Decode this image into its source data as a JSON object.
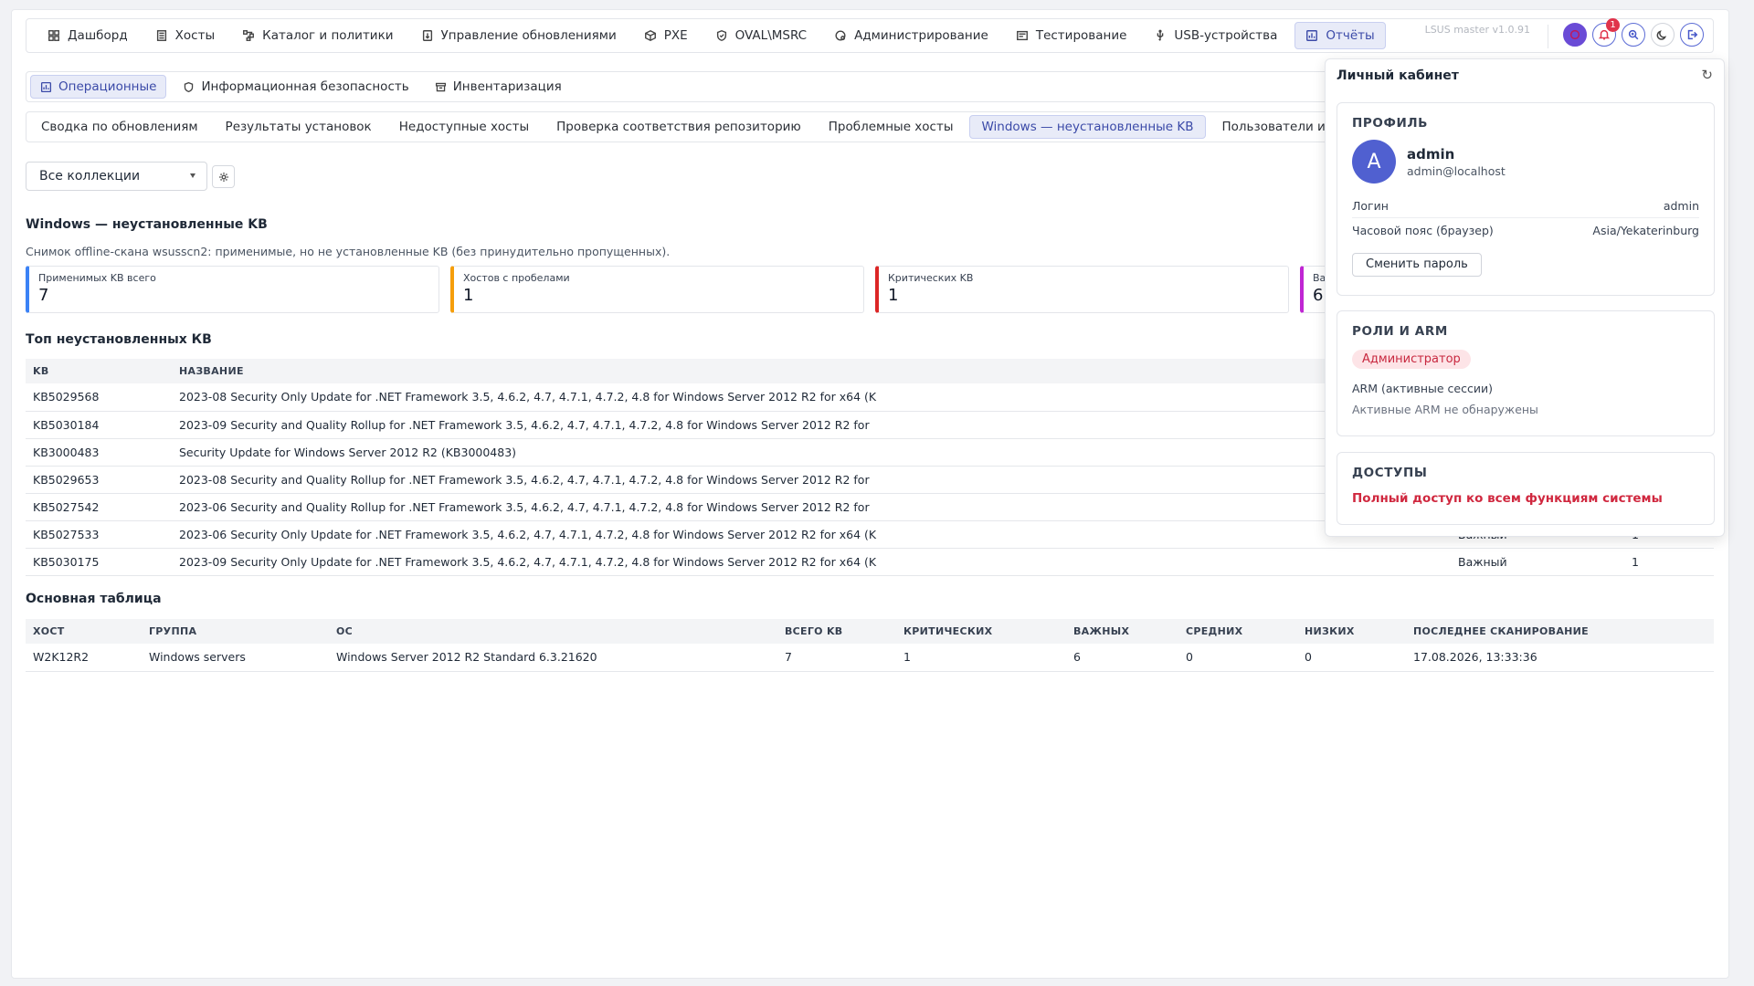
{
  "app": {
    "version": "LSUS master v1.0.91"
  },
  "topnav": {
    "items": [
      {
        "label": "Дашборд",
        "icon": "dashboard-icon"
      },
      {
        "label": "Хосты",
        "icon": "server-icon"
      },
      {
        "label": "Каталог и политики",
        "icon": "catalog-icon"
      },
      {
        "label": "Управление обновлениями",
        "icon": "update-icon"
      },
      {
        "label": "PXE",
        "icon": "cube-icon"
      },
      {
        "label": "OVAL\\MSRC",
        "icon": "shield-check-icon"
      },
      {
        "label": "Администрирование",
        "icon": "admin-icon"
      },
      {
        "label": "Тестирование",
        "icon": "test-icon"
      },
      {
        "label": "USB-устройства",
        "icon": "usb-icon"
      },
      {
        "label": "Отчёты",
        "icon": "report-icon",
        "active": true
      }
    ],
    "notifications_count": "1"
  },
  "subnav": {
    "items": [
      {
        "label": "Операционные",
        "icon": "report-icon",
        "active": true
      },
      {
        "label": "Информационная безопасность",
        "icon": "shield-icon"
      },
      {
        "label": "Инвентаризация",
        "icon": "archive-icon"
      }
    ]
  },
  "tabs": [
    {
      "label": "Сводка по обновлениям"
    },
    {
      "label": "Результаты установок"
    },
    {
      "label": "Недоступные хосты"
    },
    {
      "label": "Проверка соответствия репозиторию"
    },
    {
      "label": "Проблемные хосты"
    },
    {
      "label": "Windows — неустановленные KB",
      "active": true
    },
    {
      "label": "Пользователи и входы"
    }
  ],
  "filter": {
    "collection": "Все коллекции"
  },
  "report": {
    "title": "Windows — неустановленные KB",
    "description": "Снимок offline-скана wsusscn2: применимые, но не установленные KB (без принудительно пропущенных).",
    "cards": [
      {
        "label": "Применимых KB всего",
        "value": "7",
        "color": "#3b82f6"
      },
      {
        "label": "Хостов с пробелами",
        "value": "1",
        "color": "#f59e0b"
      },
      {
        "label": "Критических KB",
        "value": "1",
        "color": "#dc2626"
      },
      {
        "label": "Ва",
        "value": "6",
        "color": "#c026d3"
      }
    ],
    "top_title": "Топ неустановленных КВ",
    "top_columns": [
      "KB",
      "НАЗВАНИЕ",
      "",
      ""
    ],
    "top_rows": [
      {
        "kb": "KB5029568",
        "name": "2023-08 Security Only Update for .NET Framework 3.5, 4.6.2, 4.7, 4.7.1, 4.7.2, 4.8 for Windows Server 2012 R2 for x64 (K",
        "severity": "",
        "count": ""
      },
      {
        "kb": "KB5030184",
        "name": "2023-09 Security and Quality Rollup for .NET Framework 3.5, 4.6.2, 4.7, 4.7.1, 4.7.2, 4.8 for Windows Server 2012 R2 for",
        "severity": "",
        "count": ""
      },
      {
        "kb": "KB3000483",
        "name": "Security Update for Windows Server 2012 R2 (KB3000483)",
        "severity": "",
        "count": ""
      },
      {
        "kb": "KB5029653",
        "name": "2023-08 Security and Quality Rollup for .NET Framework 3.5, 4.6.2, 4.7, 4.7.1, 4.7.2, 4.8 for Windows Server 2012 R2 for",
        "severity": "",
        "count": ""
      },
      {
        "kb": "KB5027542",
        "name": "2023-06 Security and Quality Rollup for .NET Framework 3.5, 4.6.2, 4.7, 4.7.1, 4.7.2, 4.8 for Windows Server 2012 R2 for",
        "severity": "",
        "count": ""
      },
      {
        "kb": "KB5027533",
        "name": "2023-06 Security Only Update for .NET Framework 3.5, 4.6.2, 4.7, 4.7.1, 4.7.2, 4.8 for Windows Server 2012 R2 for x64 (K",
        "severity": "Важный",
        "count": "1"
      },
      {
        "kb": "KB5030175",
        "name": "2023-09 Security Only Update for .NET Framework 3.5, 4.6.2, 4.7, 4.7.1, 4.7.2, 4.8 for Windows Server 2012 R2 for x64 (K",
        "severity": "Важный",
        "count": "1"
      }
    ],
    "main_title": "Основная таблица",
    "main_columns": [
      "ХОСТ",
      "ГРУППА",
      "ОС",
      "ВСЕГО KB",
      "КРИТИЧЕСКИХ",
      "ВАЖНЫХ",
      "СРЕДНИХ",
      "НИЗКИХ",
      "ПОСЛЕДНЕЕ СКАНИРОВАНИЕ"
    ],
    "main_rows": [
      [
        "W2K12R2",
        "Windows servers",
        "Windows Server 2012 R2 Standard 6.3.21620",
        "7",
        "1",
        "6",
        "0",
        "0",
        "17.08.2026, 13:33:36"
      ]
    ]
  },
  "profile": {
    "title": "Личный кабинет",
    "profile_section": "Профиль",
    "avatar_letter": "A",
    "username": "admin",
    "email": "admin@localhost",
    "login_label": "Логин",
    "login_value": "admin",
    "tz_label": "Часовой пояс (браузер)",
    "tz_value": "Asia/Yekaterinburg",
    "change_password": "Сменить пароль",
    "roles_section": "Роли и ARM",
    "role": "Администратор",
    "arm_label": "ARM (активные сессии)",
    "arm_value": "Активные ARM не обнаружены",
    "access_section": "Доступы",
    "access_value": "Полный доступ ко всем функциям системы"
  }
}
